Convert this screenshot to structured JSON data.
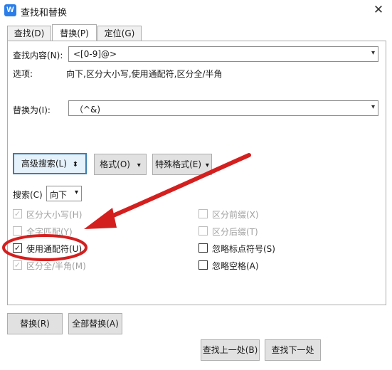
{
  "window": {
    "title": "查找和替换",
    "app_icon_letter": "W",
    "close_glyph": "✕"
  },
  "tabs": [
    {
      "label": "查找(D)",
      "active": false
    },
    {
      "label": "替换(P)",
      "active": true
    },
    {
      "label": "定位(G)",
      "active": false
    }
  ],
  "find": {
    "label": "查找内容(N):",
    "value": "<[0-9]@>"
  },
  "options": {
    "label": "选项:",
    "value": "向下,区分大小写,使用通配符,区分全/半角"
  },
  "replace": {
    "label": "替换为(I):",
    "value": "（^&)"
  },
  "buttons": {
    "advanced": "高级搜索(L)",
    "advanced_icon": "⬍",
    "format": "格式(O)",
    "special": "特殊格式(E)",
    "replace": "替换(R)",
    "replace_all": "全部替换(A)",
    "find_prev": "查找上一处(B)",
    "find_next": "查找下一处"
  },
  "search": {
    "label": "搜索(C)",
    "value": "向下"
  },
  "checkboxes_left": [
    {
      "label": "区分大小写(H)",
      "checked": true,
      "enabled": false
    },
    {
      "label": "全字匹配(Y)",
      "checked": false,
      "enabled": false
    },
    {
      "label": "使用通配符(U)",
      "checked": true,
      "enabled": true
    },
    {
      "label": "区分全/半角(M)",
      "checked": true,
      "enabled": false
    }
  ],
  "checkboxes_right": [
    {
      "label": "区分前缀(X)",
      "checked": false,
      "enabled": false
    },
    {
      "label": "区分后缀(T)",
      "checked": false,
      "enabled": false
    },
    {
      "label": "忽略标点符号(S)",
      "checked": false,
      "enabled": true
    },
    {
      "label": "忽略空格(A)",
      "checked": false,
      "enabled": true
    }
  ],
  "annotation_color": "#d41f1f",
  "check_glyph": "✓",
  "dropdown_glyph": "▾"
}
